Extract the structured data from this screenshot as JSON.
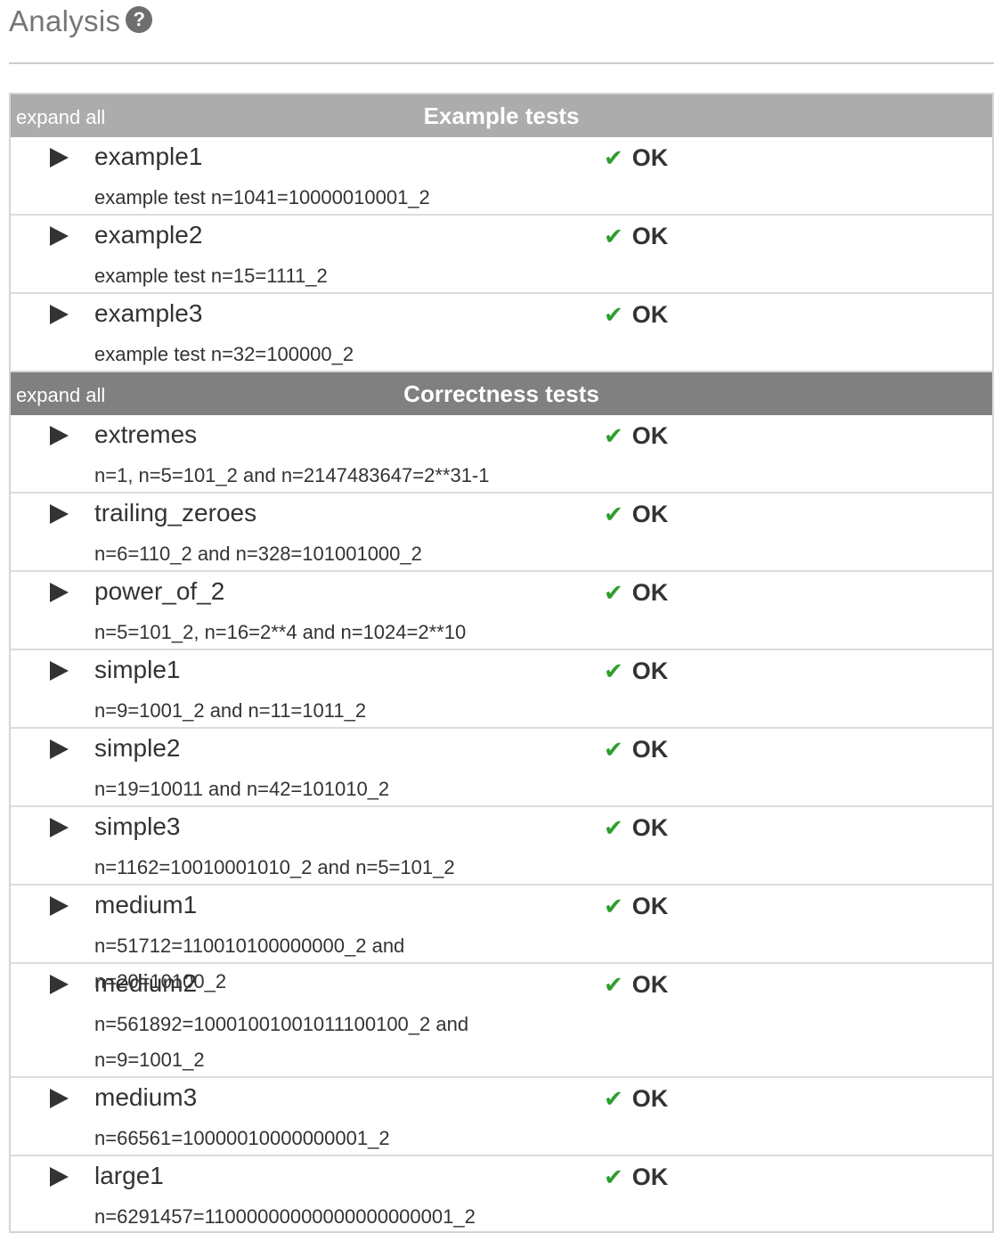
{
  "page": {
    "title": "Analysis",
    "help_icon": "question-circle-icon"
  },
  "colors": {
    "example_header": "#acacac",
    "correctness_header": "#808080",
    "ok_check": "#2e9e2e"
  },
  "groups": [
    {
      "title": "Example tests",
      "expand_label": "expand all",
      "tests": [
        {
          "name": "example1",
          "description": "example test n=1041=10000010001_2",
          "result": "OK"
        },
        {
          "name": "example2",
          "description": "example test n=15=1111_2",
          "result": "OK"
        },
        {
          "name": "example3",
          "description": "example test n=32=100000_2",
          "result": "OK"
        }
      ]
    },
    {
      "title": "Correctness tests",
      "expand_label": "expand all",
      "tests": [
        {
          "name": "extremes",
          "description": "n=1, n=5=101_2 and n=2147483647=2**31-1",
          "result": "OK"
        },
        {
          "name": "trailing_zeroes",
          "description": "n=6=110_2 and n=328=101001000_2",
          "result": "OK"
        },
        {
          "name": "power_of_2",
          "description": "n=5=101_2, n=16=2**4 and n=1024=2**10",
          "result": "OK"
        },
        {
          "name": "simple1",
          "description": "n=9=1001_2 and n=11=1011_2",
          "result": "OK"
        },
        {
          "name": "simple2",
          "description": "n=19=10011 and n=42=101010_2",
          "result": "OK"
        },
        {
          "name": "simple3",
          "description": "n=1162=10010001010_2 and n=5=101_2",
          "result": "OK"
        },
        {
          "name": "medium1",
          "description": "n=51712=110010100000000_2 and n=20=10100_2",
          "result": "OK"
        },
        {
          "name": "medium2",
          "description": "n=561892=10001001001011100100_2 and n=9=1001_2",
          "result": "OK"
        },
        {
          "name": "medium3",
          "description": "n=66561=10000010000000001_2",
          "result": "OK"
        },
        {
          "name": "large1",
          "description": "n=6291457=11000000000000000000001_2",
          "result": "OK"
        }
      ]
    }
  ]
}
